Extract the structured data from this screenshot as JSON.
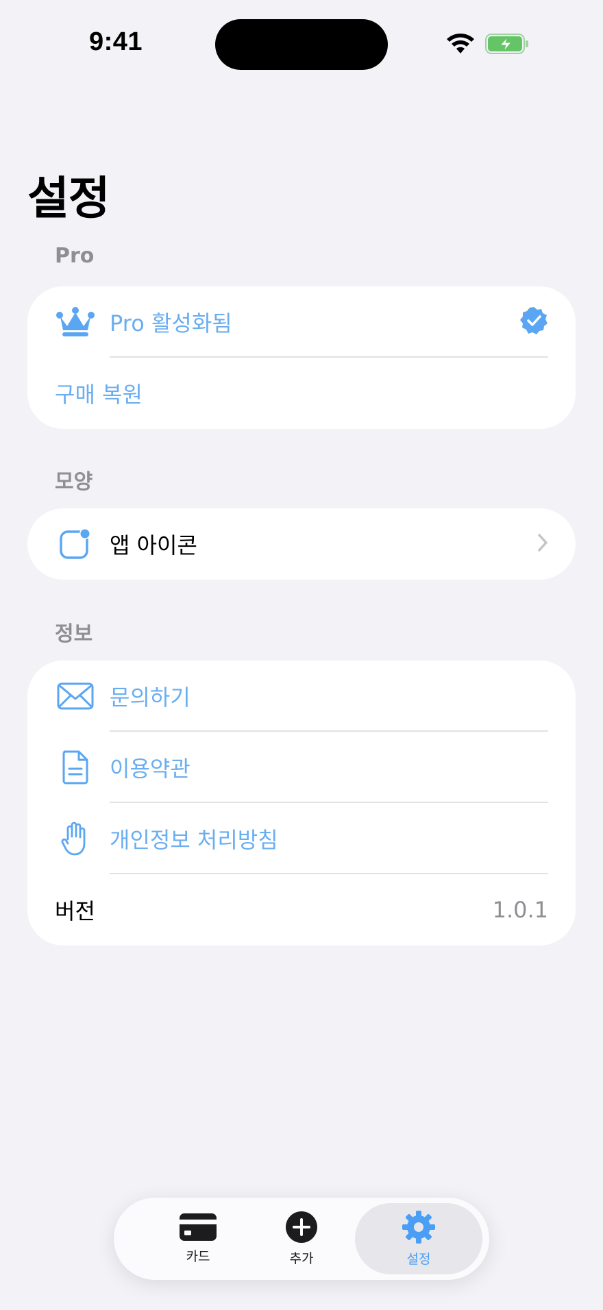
{
  "status_bar": {
    "time": "9:41"
  },
  "page": {
    "title": "설정"
  },
  "sections": {
    "pro": {
      "header": "Pro",
      "rows": {
        "pro_status": {
          "label": "Pro 활성화됨",
          "icon": "crown-icon",
          "trailing_icon": "checkmark-seal-icon"
        },
        "restore": {
          "label": "구매 복원"
        }
      }
    },
    "appearance": {
      "header": "모양",
      "rows": {
        "app_icon": {
          "label": "앱 아이콘",
          "icon": "app-icon-badge-icon",
          "trailing_icon": "chevron-right-icon"
        }
      }
    },
    "info": {
      "header": "정보",
      "rows": {
        "contact": {
          "label": "문의하기",
          "icon": "envelope-icon"
        },
        "terms": {
          "label": "이용약관",
          "icon": "document-icon"
        },
        "privacy": {
          "label": "개인정보 처리방침",
          "icon": "hand-icon"
        },
        "version": {
          "label": "버전",
          "value": "1.0.1"
        }
      }
    }
  },
  "tab_bar": {
    "tabs": [
      {
        "label": "카드",
        "icon": "card-icon"
      },
      {
        "label": "추가",
        "icon": "plus-circle-icon"
      },
      {
        "label": "설정",
        "icon": "gear-icon",
        "active": true
      }
    ]
  },
  "colors": {
    "accent": "#4a9ff5",
    "link": "#6aaef0",
    "background": "#f2f2f7",
    "battery_green": "#65c466"
  }
}
